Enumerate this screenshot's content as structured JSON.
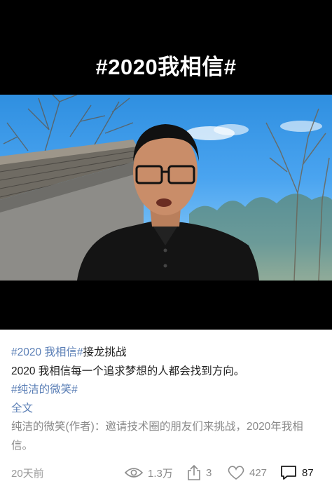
{
  "video": {
    "title": "#2020我相信#"
  },
  "post": {
    "hashtag_challenge": "#2020 我相信#",
    "challenge_text": "接龙挑战",
    "body": "2020 我相信每一个追求梦想的人都会找到方向。",
    "hashtag_topic": "#纯洁的微笑#",
    "full_text_link": "全文",
    "author_note": "纯洁的微笑(作者)：邀请技术圈的朋友们来挑战，2020年我相信。"
  },
  "footer": {
    "time": "20天前",
    "views": "1.3万",
    "shares": "3",
    "likes": "427",
    "comments": "87"
  },
  "icons": {
    "views": "eye-icon",
    "shares": "share-icon",
    "likes": "heart-icon",
    "comments": "comment-icon"
  },
  "colors": {
    "hashtag": "#5b7fb6",
    "video_bg": "#000000",
    "sky": "#4aa4f0"
  }
}
